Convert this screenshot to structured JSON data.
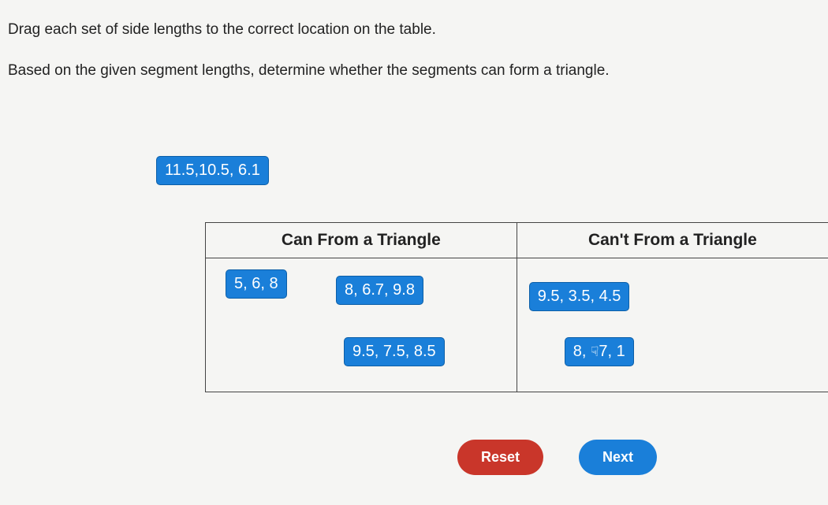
{
  "instructions": {
    "line1": "Drag each set of side lengths to the correct location on the table.",
    "line2": "Based on the given segment lengths, determine whether the segments can form a triangle."
  },
  "free_chip": "11.5,10.5, 6.1",
  "table": {
    "headers": {
      "can": "Can From a Triangle",
      "cant": "Can't From a Triangle"
    },
    "can_cells": {
      "chip1": "5, 6, 8",
      "chip2": "8, 6.7, 9.8",
      "chip3": "9.5, 7.5, 8.5"
    },
    "cant_cells": {
      "chip4": "9.5, 3.5, 4.5",
      "chip5_prefix": "8, ",
      "chip5_suffix": "7, 1"
    }
  },
  "buttons": {
    "reset": "Reset",
    "next": "Next"
  },
  "icons": {
    "hand": "☟"
  }
}
